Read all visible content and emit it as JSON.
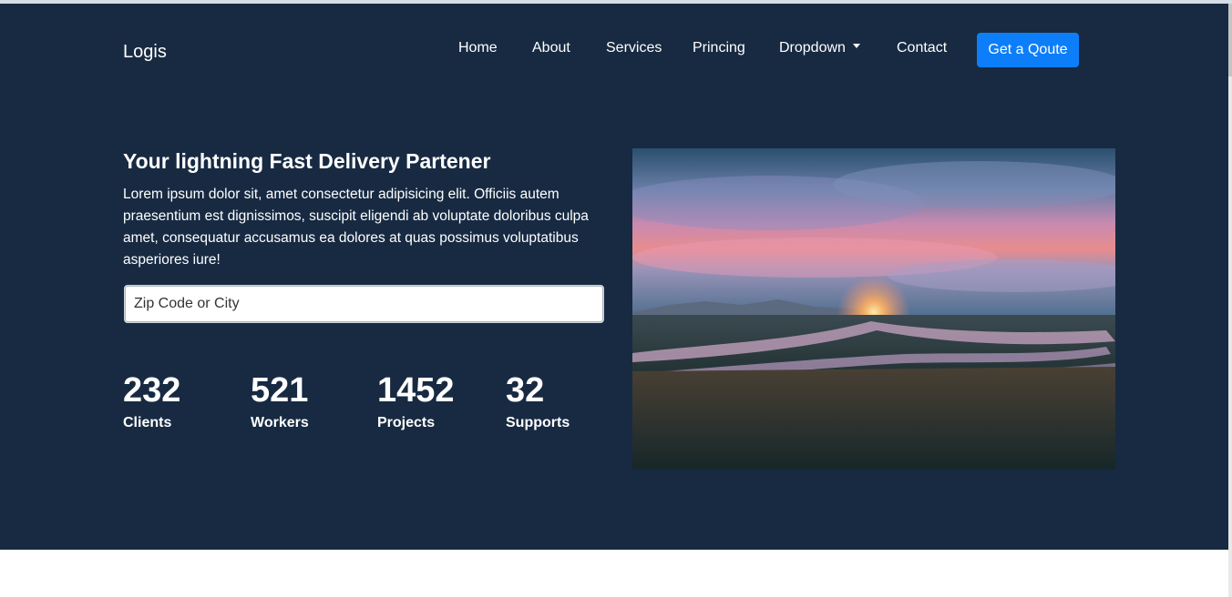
{
  "navbar": {
    "brand": "Logis",
    "links": [
      "Home",
      "About",
      "Services",
      "Princing",
      "Dropdown",
      "Contact"
    ],
    "cta_label": "Get a Qoute"
  },
  "hero": {
    "title": "Your lightning Fast Delivery Partener",
    "description": "Lorem ipsum dolor sit, amet consectetur adipisicing elit. Officiis autem praesentium est dignissimos, suscipit eligendi ab voluptate doloribus culpa amet, consequatur accusamus ea dolores at quas possimus voluptatibus asperiores iure!",
    "search_placeholder": "Zip Code or City",
    "stats": [
      {
        "value": "232",
        "label": "Clients"
      },
      {
        "value": "521",
        "label": "Workers"
      },
      {
        "value": "1452",
        "label": "Projects"
      },
      {
        "value": "32",
        "label": "Supports"
      }
    ]
  },
  "colors": {
    "hero_bg": "#172a42",
    "accent": "#0d7ef9"
  }
}
